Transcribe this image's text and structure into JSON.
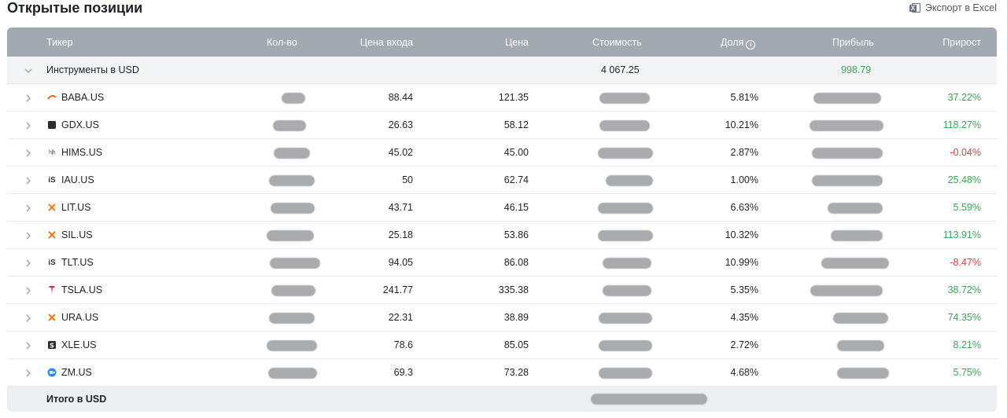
{
  "page": {
    "title": "Открытые позиции",
    "export_label": "Экспорт в Excel"
  },
  "columns": {
    "ticker": "Тикер",
    "qty": "Кол-во",
    "entry": "Цена входа",
    "price": "Цена",
    "value": "Стоимость",
    "share": "Доля",
    "profit": "Прибыль",
    "growth": "Прирост"
  },
  "group": {
    "label": "Инструменты в USD",
    "value": "4 067.25",
    "profit": "998.79"
  },
  "rows": [
    {
      "ticker": "BABA.US",
      "icon": "baba-logo-icon",
      "entry": "88.44",
      "price": "121.35",
      "share": "5.81%",
      "growth": "37.22%",
      "trend": "pos"
    },
    {
      "ticker": "GDX.US",
      "icon": "gdx-logo-icon",
      "entry": "26.63",
      "price": "58.12",
      "share": "10.21%",
      "growth": "118.27%",
      "trend": "pos"
    },
    {
      "ticker": "HIMS.US",
      "icon": "hims-logo-icon",
      "entry": "45.02",
      "price": "45.00",
      "share": "2.87%",
      "growth": "-0.04%",
      "trend": "neg"
    },
    {
      "ticker": "IAU.US",
      "icon": "ishares-logo-icon",
      "entry": "50",
      "price": "62.74",
      "share": "1.00%",
      "growth": "25.48%",
      "trend": "pos"
    },
    {
      "ticker": "LIT.US",
      "icon": "globalx-logo-icon",
      "entry": "43.71",
      "price": "46.15",
      "share": "6.63%",
      "growth": "5.59%",
      "trend": "pos"
    },
    {
      "ticker": "SIL.US",
      "icon": "globalx-logo-icon",
      "entry": "25.18",
      "price": "53.86",
      "share": "10.32%",
      "growth": "113.91%",
      "trend": "pos"
    },
    {
      "ticker": "TLT.US",
      "icon": "ishares-logo-icon",
      "entry": "94.05",
      "price": "86.08",
      "share": "10.99%",
      "growth": "-8.47%",
      "trend": "neg"
    },
    {
      "ticker": "TSLA.US",
      "icon": "tesla-logo-icon",
      "entry": "241.77",
      "price": "335.38",
      "share": "5.35%",
      "growth": "38.72%",
      "trend": "pos"
    },
    {
      "ticker": "URA.US",
      "icon": "globalx-logo-icon",
      "entry": "22.31",
      "price": "38.89",
      "share": "4.35%",
      "growth": "74.35%",
      "trend": "pos"
    },
    {
      "ticker": "XLE.US",
      "icon": "spdr-logo-icon",
      "entry": "78.6",
      "price": "85.05",
      "share": "2.72%",
      "growth": "8.21%",
      "trend": "pos"
    },
    {
      "ticker": "ZM.US",
      "icon": "zoom-logo-icon",
      "entry": "69.3",
      "price": "73.28",
      "share": "4.68%",
      "growth": "5.75%",
      "trend": "pos"
    }
  ],
  "total": {
    "label": "Итого в USD"
  },
  "colors": {
    "header_bg": "#a3a9b1",
    "positive": "#3aa657",
    "negative": "#d9403e"
  }
}
